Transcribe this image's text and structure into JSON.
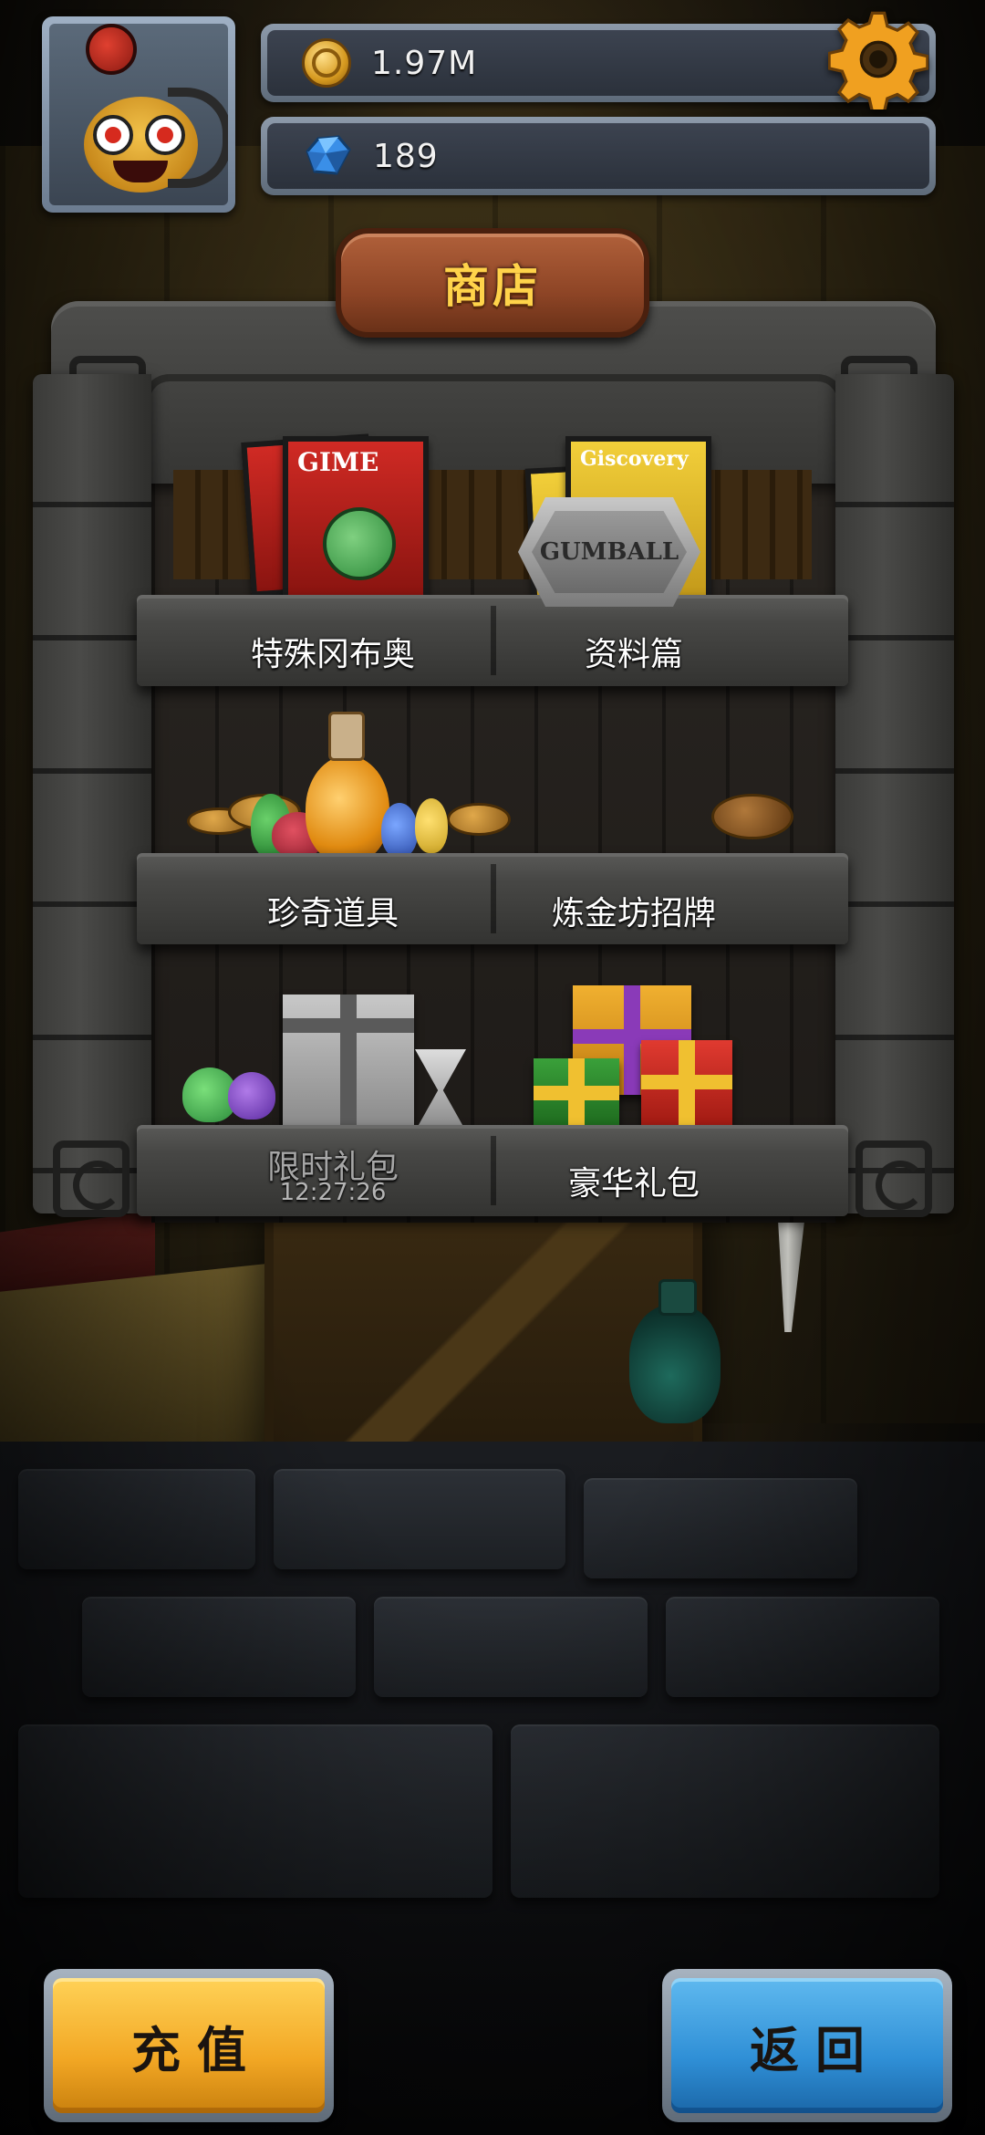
{
  "hud": {
    "coins": "1.97M",
    "gems": "189",
    "coin_icon": "coin-icon",
    "gem_icon": "gem-icon",
    "settings_icon": "gear-icon"
  },
  "shop": {
    "title": "商店",
    "shelves": [
      {
        "id": "special",
        "label": "特殊冈布奥",
        "item_art": "magazine-gime"
      },
      {
        "id": "info",
        "label": "资料篇",
        "item_art": "magazine-giscovery"
      },
      {
        "id": "rare-items",
        "label": "珍奇道具",
        "item_art": "potions-and-coins"
      },
      {
        "id": "alchemy-sign",
        "label": "炼金坊招牌",
        "item_art": "gumball-sign"
      },
      {
        "id": "limited-pack",
        "label": "限时礼包",
        "timer": "12:27:26",
        "item_art": "gray-gift-box"
      },
      {
        "id": "deluxe-pack",
        "label": "豪华礼包",
        "item_art": "colorful-gift-boxes"
      }
    ],
    "magazine_titles": {
      "gime": "GIME",
      "giscovery": "Giscovery"
    },
    "sign_text": "GUMBALL"
  },
  "buttons": {
    "recharge": "充值",
    "back": "返回"
  },
  "colors": {
    "recharge_button": "#f2a724",
    "back_button": "#2f8fd6",
    "title_text": "#ffd34a",
    "sign_wood": "#8e4526"
  }
}
